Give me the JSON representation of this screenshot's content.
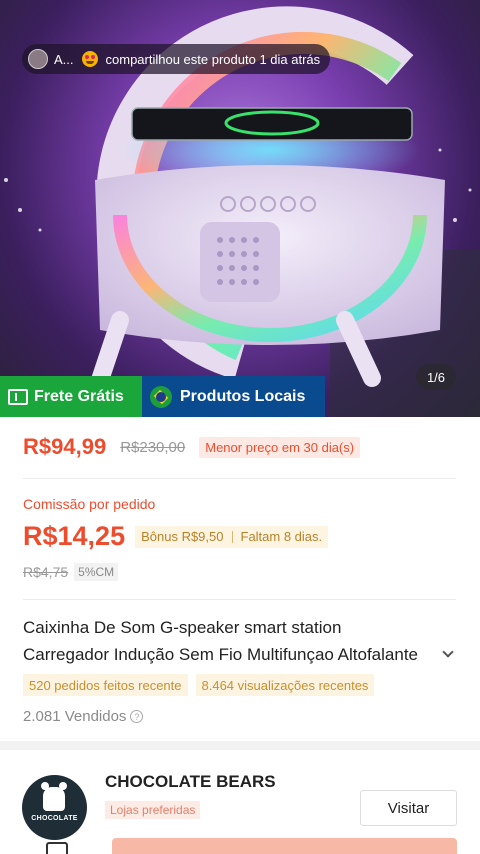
{
  "hero": {
    "share_text_prefix": "A...",
    "share_text_suffix": "compartilhou este produto 1 dia atrás",
    "image_counter": "1/6",
    "tag_frete": "Frete Grátis",
    "tag_locais": "Produtos Locais"
  },
  "price": {
    "current": "R$94,99",
    "original": "R$230,00",
    "badge": "Menor preço em 30 dia(s)"
  },
  "commission": {
    "label": "Comissão por pedido",
    "value": "R$14,25",
    "bonus": "Bônus R$9,50",
    "remaining": "Faltam 8 dias.",
    "old_value": "R$4,75",
    "old_rate": "5%CM"
  },
  "product": {
    "title_line1": "Caixinha De Som G-speaker smart station",
    "title_line2": "Carregador Indução Sem Fio Multifunçao Altofalante",
    "orders_chip": "520 pedidos feitos recente",
    "views_chip": "8.464 visualizações recentes",
    "sold": "2.081 Vendidos"
  },
  "shop": {
    "name": "CHOCOLATE BEARS",
    "tag": "Lojas preferidas",
    "visit_label": "Visitar",
    "avatar_text": "CHOCOLATE"
  },
  "colors": {
    "accent": "#ee4d2d",
    "frete": "#1aa63b",
    "locais": "#0a4a8f"
  }
}
